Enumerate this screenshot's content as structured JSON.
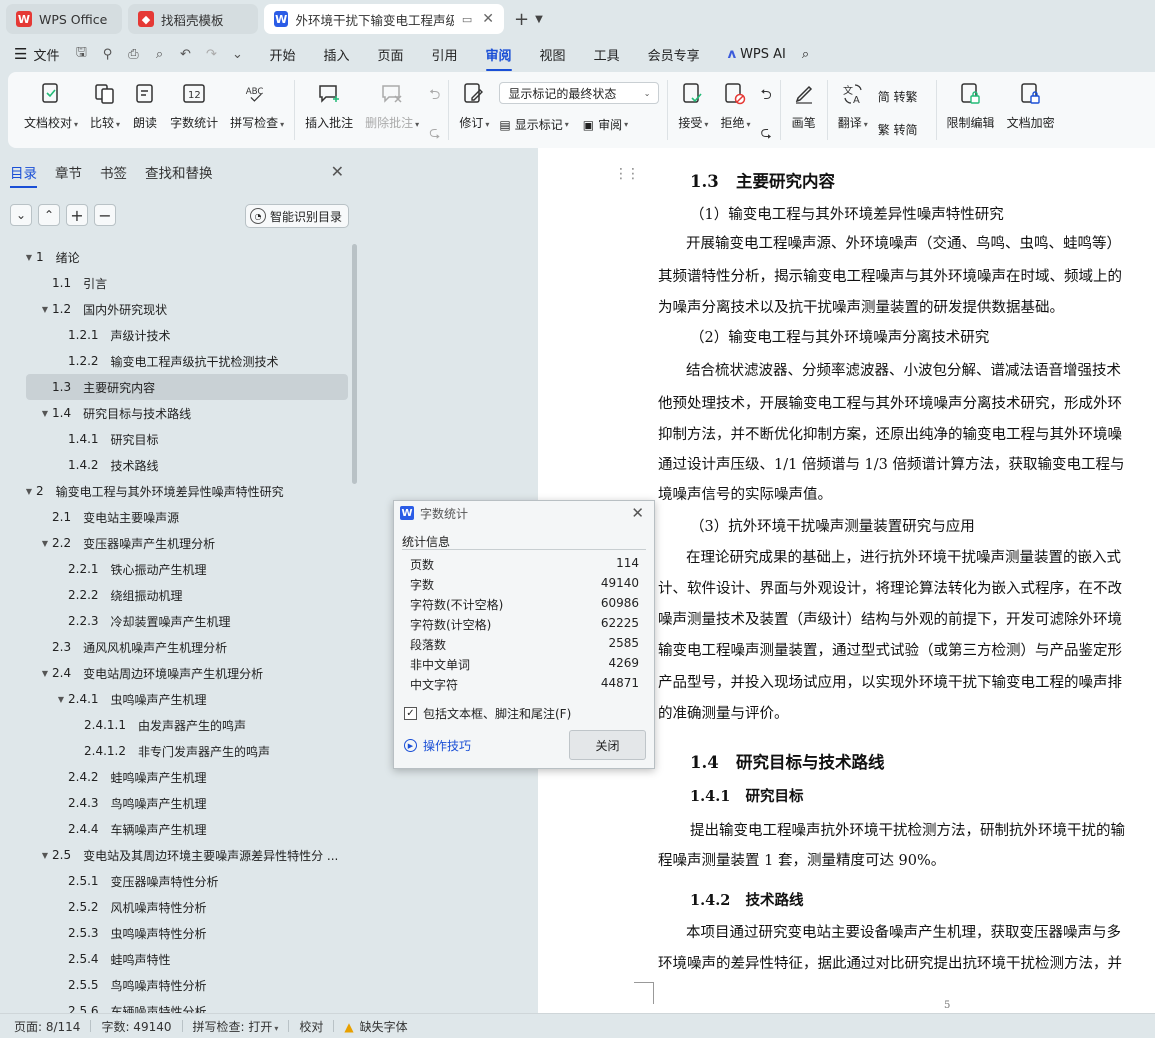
{
  "tabs": [
    {
      "label": "WPS Office",
      "icon": "wps-icon",
      "color": "#e53935"
    },
    {
      "label": "找稻壳模板",
      "icon": "docer-icon",
      "color": "#e53935"
    },
    {
      "label": "外环境干扰下输变电工程声级测",
      "icon": "writer-icon",
      "color": "#2b5ce6"
    }
  ],
  "menubar": {
    "file": "文件",
    "items": [
      "开始",
      "插入",
      "页面",
      "引用",
      "审阅",
      "视图",
      "工具",
      "会员专享"
    ],
    "active": "审阅",
    "ai": "WPS AI"
  },
  "ribbon": {
    "doc_check": "文档校对",
    "compare": "比较",
    "read_aloud": "朗读",
    "word_count": "字数统计",
    "spell_check": "拼写检查",
    "insert_comment": "插入批注",
    "delete_comment": "删除批注",
    "revise": "修订",
    "markup_select": "显示标记的最终状态",
    "show_markup": "显示标记",
    "review": "审阅",
    "accept": "接受",
    "reject": "拒绝",
    "pen": "画笔",
    "translate": "翻译",
    "to_trad": "简 转繁",
    "to_simp": "繁 转简",
    "restrict": "限制编辑",
    "encrypt": "文档加密"
  },
  "nav": {
    "tabs": [
      "目录",
      "章节",
      "书签",
      "查找和替换"
    ],
    "active": "目录",
    "smart_btn": "智能识别目录",
    "toc": [
      {
        "level": 0,
        "arrow": true,
        "num": "1",
        "text": "绪论"
      },
      {
        "level": 1,
        "arrow": false,
        "num": "1.1",
        "text": "引言"
      },
      {
        "level": 1,
        "arrow": true,
        "num": "1.2",
        "text": "国内外研究现状"
      },
      {
        "level": 2,
        "arrow": false,
        "num": "1.2.1",
        "text": "声级计技术"
      },
      {
        "level": 2,
        "arrow": false,
        "num": "1.2.2",
        "text": "输变电工程声级抗干扰检测技术"
      },
      {
        "level": 1,
        "arrow": false,
        "num": "1.3",
        "text": "主要研究内容",
        "selected": true
      },
      {
        "level": 1,
        "arrow": true,
        "num": "1.4",
        "text": "研究目标与技术路线"
      },
      {
        "level": 2,
        "arrow": false,
        "num": "1.4.1",
        "text": "研究目标"
      },
      {
        "level": 2,
        "arrow": false,
        "num": "1.4.2",
        "text": "技术路线"
      },
      {
        "level": 0,
        "arrow": true,
        "num": "2",
        "text": "输变电工程与其外环境差异性噪声特性研究"
      },
      {
        "level": 1,
        "arrow": false,
        "num": "2.1",
        "text": "变电站主要噪声源"
      },
      {
        "level": 1,
        "arrow": true,
        "num": "2.2",
        "text": "变压器噪声产生机理分析"
      },
      {
        "level": 2,
        "arrow": false,
        "num": "2.2.1",
        "text": "铁心振动产生机理"
      },
      {
        "level": 2,
        "arrow": false,
        "num": "2.2.2",
        "text": "绕组振动机理"
      },
      {
        "level": 2,
        "arrow": false,
        "num": "2.2.3",
        "text": "冷却装置噪声产生机理"
      },
      {
        "level": 1,
        "arrow": false,
        "num": "2.3",
        "text": "通风风机噪声产生机理分析"
      },
      {
        "level": 1,
        "arrow": true,
        "num": "2.4",
        "text": "变电站周边环境噪声产生机理分析"
      },
      {
        "level": 2,
        "arrow": true,
        "num": "2.4.1",
        "text": "虫鸣噪声产生机理"
      },
      {
        "level": 3,
        "arrow": false,
        "num": "2.4.1.1",
        "text": "由发声器产生的鸣声"
      },
      {
        "level": 3,
        "arrow": false,
        "num": "2.4.1.2",
        "text": "非专门发声器产生的鸣声"
      },
      {
        "level": 2,
        "arrow": false,
        "num": "2.4.2",
        "text": "蛙鸣噪声产生机理"
      },
      {
        "level": 2,
        "arrow": false,
        "num": "2.4.3",
        "text": "鸟鸣噪声产生机理"
      },
      {
        "level": 2,
        "arrow": false,
        "num": "2.4.4",
        "text": "车辆噪声产生机理"
      },
      {
        "level": 1,
        "arrow": true,
        "num": "2.5",
        "text": "变电站及其周边环境主要噪声源差异性特性分 ..."
      },
      {
        "level": 2,
        "arrow": false,
        "num": "2.5.1",
        "text": "变压器噪声特性分析"
      },
      {
        "level": 2,
        "arrow": false,
        "num": "2.5.2",
        "text": "风机噪声特性分析"
      },
      {
        "level": 2,
        "arrow": false,
        "num": "2.5.3",
        "text": "虫鸣噪声特性分析"
      },
      {
        "level": 2,
        "arrow": false,
        "num": "2.5.4",
        "text": "蛙鸣声特性"
      },
      {
        "level": 2,
        "arrow": false,
        "num": "2.5.5",
        "text": "鸟鸣噪声特性分析"
      },
      {
        "level": 2,
        "arrow": false,
        "num": "2.5.6",
        "text": "车辆噪声特性分析"
      }
    ]
  },
  "doc": {
    "lines": [
      {
        "cls": "h2",
        "indent": 32,
        "text": "1.3   主要研究内容"
      },
      {
        "cls": "",
        "indent": 32,
        "text": "（1）输变电工程与其外环境差异性噪声特性研究"
      },
      {
        "cls": "",
        "indent": 28,
        "text": "开展输变电工程噪声源、外环境噪声（交通、鸟鸣、虫鸣、蛙鸣等）"
      },
      {
        "cls": "",
        "indent": 0,
        "text": "其频谱特性分析，揭示输变电工程噪声与其外环境噪声在时域、频域上的"
      },
      {
        "cls": "",
        "indent": 0,
        "text": "为噪声分离技术以及抗干扰噪声测量装置的研发提供数据基础。"
      },
      {
        "cls": "",
        "indent": 32,
        "text": "（2）输变电工程与其外环境噪声分离技术研究"
      },
      {
        "cls": "",
        "indent": 28,
        "text": "结合梳状滤波器、分频率滤波器、小波包分解、谱减法语音增强技术"
      },
      {
        "cls": "",
        "indent": 0,
        "text": "他预处理技术，开展输变电工程与其外环境噪声分离技术研究，形成外环"
      },
      {
        "cls": "",
        "indent": 0,
        "text": "抑制方法，并不断优化抑制方案，还原出纯净的输变电工程与其外环境噪"
      },
      {
        "cls": "",
        "indent": 0,
        "text": "通过设计声压级、1/1 倍频谱与 1/3 倍频谱计算方法，获取输变电工程与"
      },
      {
        "cls": "",
        "indent": 0,
        "text": "境噪声信号的实际噪声值。"
      },
      {
        "cls": "",
        "indent": 32,
        "text": "（3）抗外环境干扰噪声测量装置研究与应用"
      },
      {
        "cls": "",
        "indent": 28,
        "text": "在理论研究成果的基础上，进行抗外环境干扰噪声测量装置的嵌入式"
      },
      {
        "cls": "",
        "indent": 0,
        "text": "计、软件设计、界面与外观设计，将理论算法转化为嵌入式程序，在不改"
      },
      {
        "cls": "",
        "indent": 0,
        "text": "噪声测量技术及装置（声级计）结构与外观的前提下，开发可滤除外环境"
      },
      {
        "cls": "",
        "indent": 0,
        "text": "输变电工程噪声测量装置，通过型式试验（或第三方检测）与产品鉴定形"
      },
      {
        "cls": "",
        "indent": 0,
        "text": "产品型号，并投入现场试应用，以实现外环境干扰下输变电工程的噪声排"
      },
      {
        "cls": "",
        "indent": 0,
        "text": "的准确测量与评价。"
      },
      {
        "cls": "h2",
        "indent": 32,
        "text": "1.4   研究目标与技术路线"
      },
      {
        "cls": "h3",
        "indent": 32,
        "text": "1.4.1   研究目标"
      },
      {
        "cls": "",
        "indent": 32,
        "text": "提出输变电工程噪声抗外环境干扰检测方法，研制抗外环境干扰的输"
      },
      {
        "cls": "",
        "indent": 0,
        "text": "程噪声测量装置 1 套，测量精度可达 90%。"
      },
      {
        "cls": "h3",
        "indent": 32,
        "text": "1.4.2   技术路线"
      },
      {
        "cls": "",
        "indent": 28,
        "text": "本项目通过研究变电站主要设备噪声产生机理，获取变压器噪声与多"
      },
      {
        "cls": "",
        "indent": 0,
        "text": "环境噪声的差异性特征，据此通过对比研究提出抗环境干扰检测方法，并"
      }
    ],
    "page_number": "5"
  },
  "dialog": {
    "title": "字数统计",
    "section": "统计信息",
    "stats": [
      {
        "label": "页数",
        "value": "114"
      },
      {
        "label": "字数",
        "value": "49140"
      },
      {
        "label": "字符数(不计空格)",
        "value": "60986"
      },
      {
        "label": "字符数(计空格)",
        "value": "62225"
      },
      {
        "label": "段落数",
        "value": "2585"
      },
      {
        "label": "非中文单词",
        "value": "4269"
      },
      {
        "label": "中文字符",
        "value": "44871"
      }
    ],
    "checkbox": "包括文本框、脚注和尾注(F)",
    "tips": "操作技巧",
    "close": "关闭"
  },
  "status": {
    "page": "页面: 8/114",
    "words": "字数: 49140",
    "spell": "拼写检查: 打开",
    "proof": "校对",
    "missing_font": "缺失字体"
  }
}
